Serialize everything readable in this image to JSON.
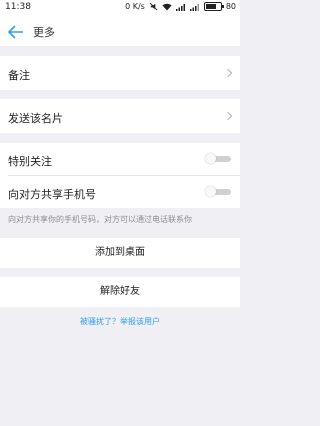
{
  "status_bar": {
    "time": "11:38",
    "network_speed": "0 K/s",
    "battery_level": "80"
  },
  "header": {
    "title": "更多"
  },
  "settings": {
    "remark_label": "备注",
    "send_card_label": "发送该名片",
    "special_follow_label": "特别关注",
    "share_phone_label": "向对方共享手机号",
    "share_phone_hint": "向对方共享你的手机号码，对方可以通过电话联系你"
  },
  "actions": {
    "add_to_desktop": "添加到桌面",
    "remove_friend": "解除好友",
    "report_link": "被骚扰了？举报该用户"
  },
  "toggles": {
    "special_follow_on": false,
    "share_phone_on": false
  },
  "colors": {
    "accent": "#2f9ef0",
    "background": "#efeff4"
  }
}
